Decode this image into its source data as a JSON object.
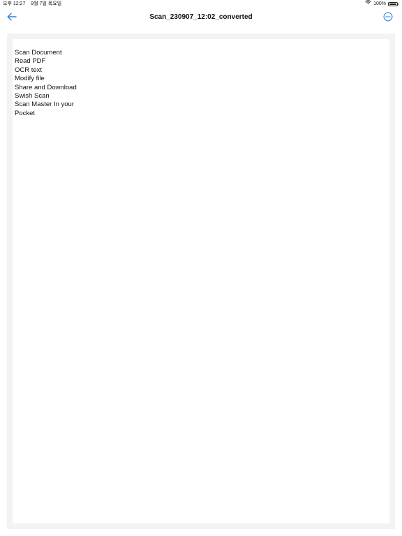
{
  "status_bar": {
    "time": "오후 12:27",
    "date": "9월 7일 목요일",
    "battery": "100%"
  },
  "nav": {
    "title": "Scan_230907_12:02_converted",
    "back_icon": "arrow-left-icon",
    "more_icon": "ellipsis-circle-icon",
    "accent_color": "#2f7fe0"
  },
  "document": {
    "lines": [
      "Scan Document",
      "Read PDF",
      "OCR text",
      "Modify file",
      "Share and Download",
      "Swish Scan",
      "Scan Master In your",
      "Pocket"
    ]
  }
}
